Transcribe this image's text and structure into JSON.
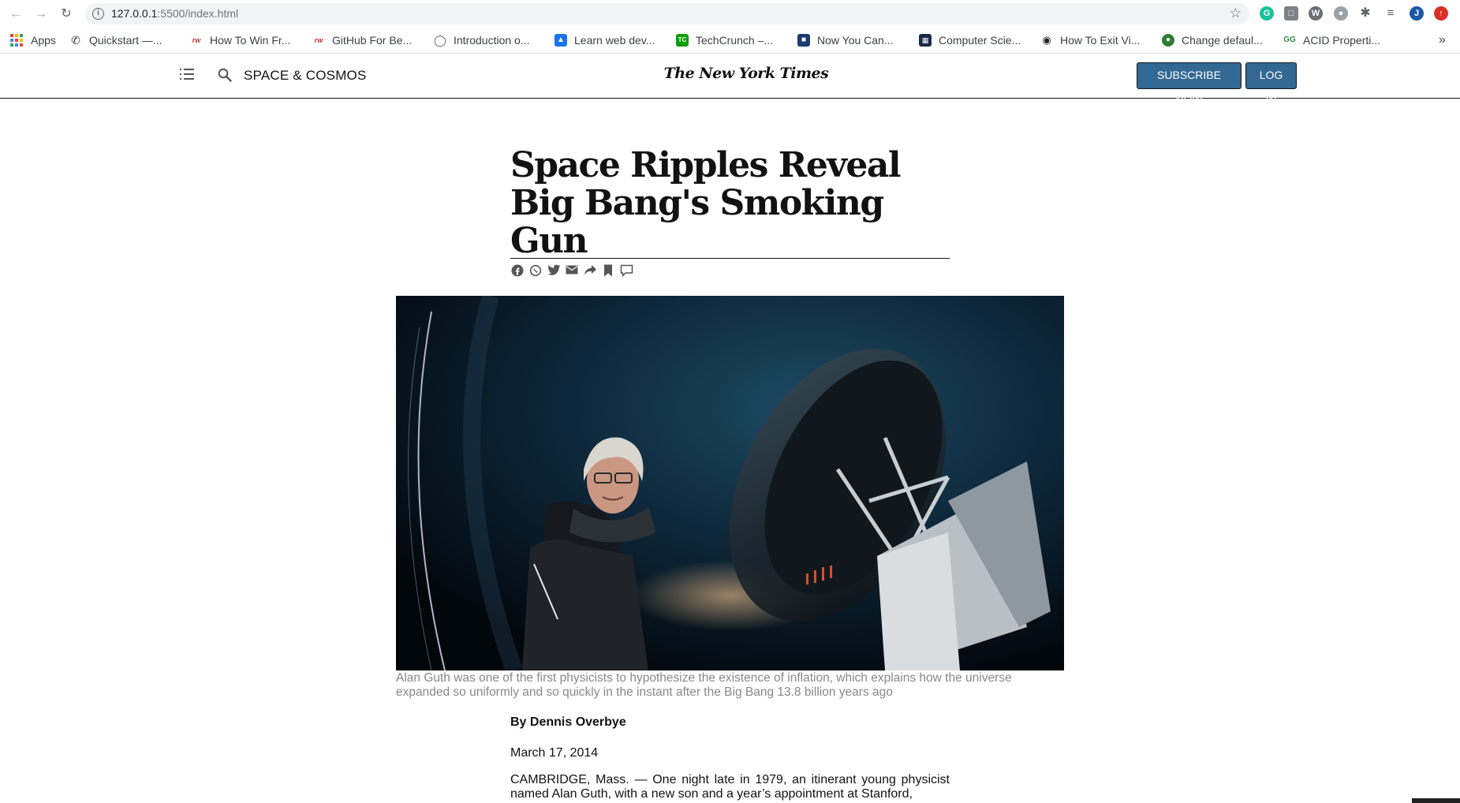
{
  "browser": {
    "url_host": "127.0.0.1",
    "url_path": ":5500/index.html",
    "bookmarks": [
      {
        "label": "Apps"
      },
      {
        "label": "Quickstart —..."
      },
      {
        "label": "How To Win Fr..."
      },
      {
        "label": "GitHub For Be..."
      },
      {
        "label": "Introduction o..."
      },
      {
        "label": "Learn web dev..."
      },
      {
        "label": "TechCrunch –..."
      },
      {
        "label": "Now You Can..."
      },
      {
        "label": "Computer Scie..."
      },
      {
        "label": "How To Exit Vi..."
      },
      {
        "label": "Change defaul..."
      },
      {
        "label": "ACID Properti..."
      }
    ],
    "overflow_label": "»",
    "profile_initial": "J"
  },
  "header": {
    "section": "SPACE & COSMOS",
    "masthead": "The New York Times",
    "subscribe_label": "SUBSCRIBE NOW",
    "login_label": "LOG IN",
    "accent_color": "#326891"
  },
  "article": {
    "headline": "Space Ripples Reveal Big Bang's Smoking Gun",
    "share_icons": [
      "facebook-icon",
      "whatsapp-icon",
      "twitter-icon",
      "email-icon",
      "share-icon",
      "bookmark-icon",
      "comment-icon"
    ],
    "caption": "Alan Guth was one of the first physicists to hypothesize the existence of inflation, which explains how the universe expanded so uniformly and so quickly in the instant after the Big Bang 13.8 billion years ago",
    "byline": "By Dennis Overbye",
    "date": "March 17, 2014",
    "body": "CAMBRIDGE, Mass. — One night late in 1979, an itinerant young physicist named Alan Guth, with a new son and a year’s appointment at Stanford,"
  }
}
